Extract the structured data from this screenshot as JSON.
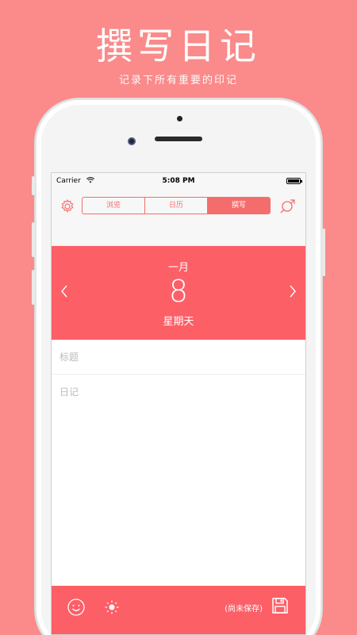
{
  "promo": {
    "title": "撰写日记",
    "subtitle": "记录下所有重要的印记"
  },
  "status_bar": {
    "carrier": "Carrier",
    "time": "5:08 PM"
  },
  "nav": {
    "tabs": [
      {
        "label": "浏览",
        "active": false
      },
      {
        "label": "日历",
        "active": false
      },
      {
        "label": "撰写",
        "active": true
      }
    ]
  },
  "date": {
    "month": "一月",
    "day": "8",
    "weekday": "星期天"
  },
  "editor": {
    "title_placeholder": "标题",
    "body_placeholder": "日记"
  },
  "bottom_bar": {
    "save_status": "(尚未保存)"
  },
  "colors": {
    "background": "#fb8a8a",
    "accent": "#fd5f67"
  },
  "icons": [
    "wifi-icon",
    "battery-icon",
    "gear-icon",
    "search-icon",
    "chevron-left-icon",
    "chevron-right-icon",
    "smile-icon",
    "sun-icon",
    "save-icon"
  ]
}
